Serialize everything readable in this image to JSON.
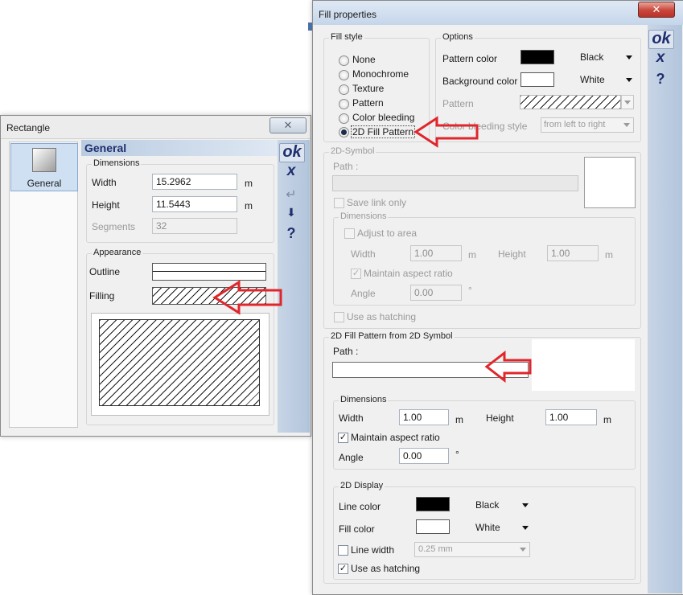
{
  "rect_dialog": {
    "title": "Rectangle",
    "nav_item": "General",
    "header": "General",
    "dimensions_label": "Dimensions",
    "width_label": "Width",
    "width_value": "15.2962",
    "width_unit": "m",
    "height_label": "Height",
    "height_value": "11.5443",
    "height_unit": "m",
    "segments_label": "Segments",
    "segments_value": "32",
    "appearance_label": "Appearance",
    "outline_label": "Outline",
    "filling_label": "Filling",
    "ok": "ok",
    "x": "x",
    "help": "?"
  },
  "fill_dialog": {
    "title": "Fill properties",
    "fill_style_label": "Fill style",
    "fill_styles": [
      "None",
      "Monochrome",
      "Texture",
      "Pattern",
      "Color bleeding",
      "2D Fill Pattern"
    ],
    "selected_fill_style": "2D Fill Pattern",
    "options_label": "Options",
    "pattern_color_label": "Pattern color",
    "pattern_color_value": "Black",
    "background_color_label": "Background color",
    "background_color_value": "White",
    "pattern_label": "Pattern",
    "color_bleeding_style_label": "Color bleeding style",
    "color_bleeding_style_value": "from left to right",
    "symbol2d_label": "2D-Symbol",
    "path_label": "Path :",
    "save_link_only": "Save link only",
    "dimensions_label": "Dimensions",
    "adjust_to_area": "Adjust to area",
    "width_label": "Width",
    "height_label": "Height",
    "sym_width": "1.00",
    "sym_height": "1.00",
    "unit_m": "m",
    "maintain_aspect": "Maintain aspect ratio",
    "angle_label": "Angle",
    "sym_angle": "0.00",
    "deg": "°",
    "use_as_hatching": "Use as hatching",
    "fill_pattern_from_symbol_label": "2D Fill Pattern from 2D Symbol",
    "path2_label": "Path :",
    "dimensions2_label": "Dimensions",
    "width2_value": "1.00",
    "height2_value": "1.00",
    "maintain_aspect2": "Maintain aspect ratio",
    "angle2_value": "0.00",
    "display2d_label": "2D Display",
    "line_color_label": "Line color",
    "line_color_value": "Black",
    "fill_color_label": "Fill color",
    "fill_color_value": "White",
    "line_width_label": "Line width",
    "line_width_value": "0.25 mm",
    "use_as_hatching2": "Use as hatching",
    "ok": "ok",
    "x": "x",
    "help": "?"
  },
  "colors": {
    "accent_navy": "#1f2f6e",
    "annotation_red": "#e0262b",
    "black_swatch": "#000000",
    "white_swatch": "#ffffff"
  }
}
